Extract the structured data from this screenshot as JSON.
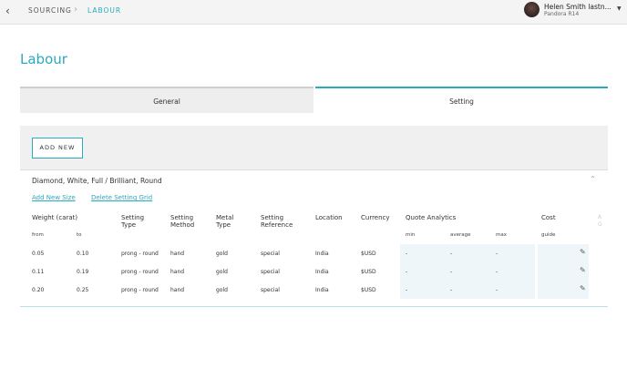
{
  "breadcrumb": {
    "root": "SOURCING",
    "current": "LABOUR"
  },
  "user": {
    "name": "Helen Smith lastn...",
    "org": "Pandora R14"
  },
  "page": {
    "title": "Labour"
  },
  "tabs": [
    {
      "label": "General"
    },
    {
      "label": "Setting"
    }
  ],
  "actions": {
    "add_new": "ADD NEW"
  },
  "group": {
    "title": "Diamond, White, Full / Brilliant, Round",
    "add_size": "Add New Size",
    "delete_grid": "Delete Setting Grid"
  },
  "table": {
    "headers": {
      "weight": "Weight (carat)",
      "setting_type": "Setting Type",
      "setting_method": "Setting Method",
      "metal_type": "Metal Type",
      "setting_reference": "Setting Reference",
      "location": "Location",
      "currency": "Currency",
      "quote_analytics": "Quote Analytics",
      "cost": "Cost"
    },
    "subheaders": {
      "from": "from",
      "to": "to",
      "min": "min",
      "average": "average",
      "max": "max",
      "guide": "guide"
    },
    "rows": [
      {
        "from": "0.05",
        "to": "0.10",
        "type": "prong - round",
        "method": "hand",
        "metal": "gold",
        "reference": "special",
        "location": "India",
        "currency": "$USD",
        "min": "-",
        "average": "-",
        "max": "-"
      },
      {
        "from": "0.11",
        "to": "0.19",
        "type": "prong - round",
        "method": "hand",
        "metal": "gold",
        "reference": "special",
        "location": "India",
        "currency": "$USD",
        "min": "-",
        "average": "-",
        "max": "-"
      },
      {
        "from": "0.20",
        "to": "0.25",
        "type": "prong - round",
        "method": "hand",
        "metal": "gold",
        "reference": "special",
        "location": "India",
        "currency": "$USD",
        "min": "-",
        "average": "-",
        "max": "-"
      }
    ]
  }
}
